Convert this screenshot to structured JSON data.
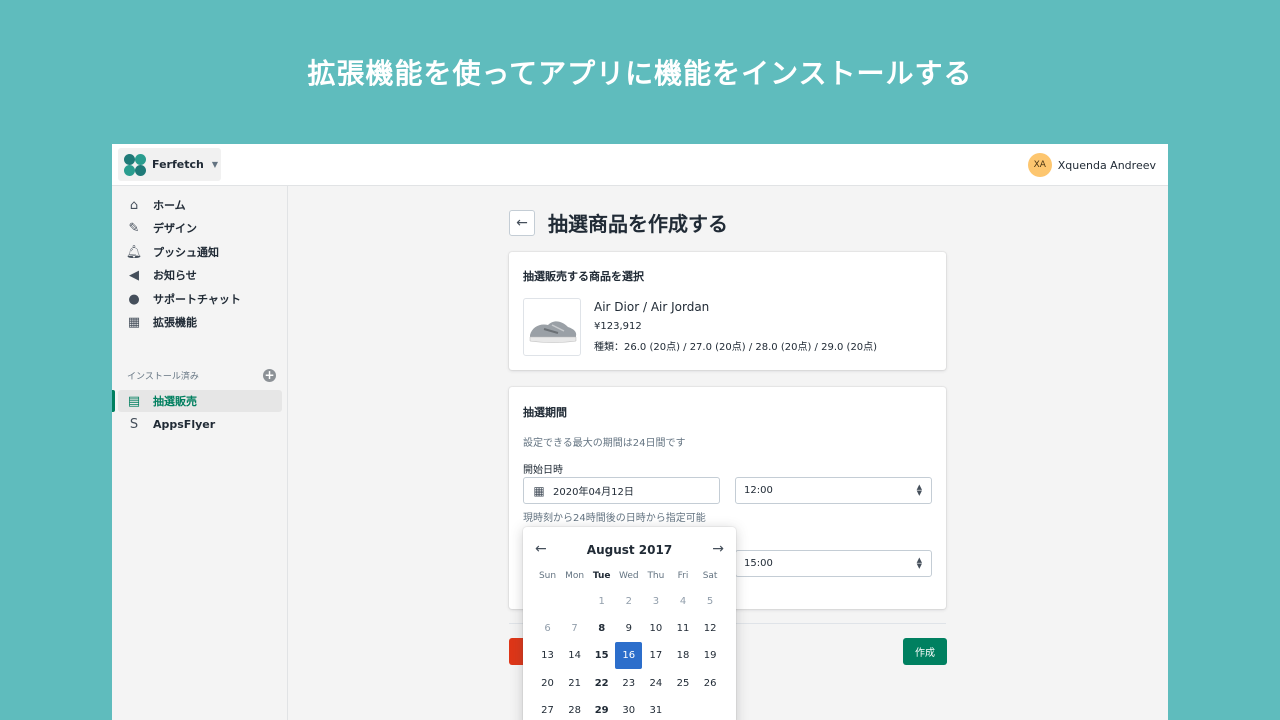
{
  "headline": "拡張機能を使ってアプリに機能をインストールする",
  "topbar": {
    "store_name": "Ferfetch",
    "user_initials": "XA",
    "user_name": "Xquenda Andreev"
  },
  "sidebar": {
    "items": [
      {
        "label": "ホーム",
        "icon": "home-icon"
      },
      {
        "label": "デザイン",
        "icon": "design-icon"
      },
      {
        "label": "プッシュ通知",
        "icon": "bell-icon"
      },
      {
        "label": "お知らせ",
        "icon": "megaphone-icon"
      },
      {
        "label": "サポートチャット",
        "icon": "chat-icon"
      },
      {
        "label": "拡張機能",
        "icon": "apps-icon"
      }
    ],
    "installed_label": "インストール済み",
    "installed_items": [
      {
        "label": "抽選販売",
        "icon": "store-icon",
        "active": true
      },
      {
        "label": "AppsFlyer",
        "icon": "shopping-bag-icon",
        "active": false
      }
    ]
  },
  "page": {
    "title": "抽選商品を作成する"
  },
  "product_card": {
    "title": "抽選販売する商品を選択",
    "product_name": "Air Dior / Air Jordan",
    "price": "¥123,912",
    "variants": "種類：26.0 (20点) / 27.0 (20点) / 28.0 (20点) / 29.0 (20点)"
  },
  "period_card": {
    "title": "抽選期間",
    "help_text": "設定できる最大の期間は24日間です",
    "start_label": "開始日時",
    "start_date": "2020年04月12日",
    "start_time": "12:00",
    "end_time": "15:00",
    "hint": "現時刻から24時間後の日時から指定可能"
  },
  "actions": {
    "create_label": "作成"
  },
  "datepicker": {
    "month_label": "August 2017",
    "weekdays": [
      "Sun",
      "Mon",
      "Tue",
      "Wed",
      "Thu",
      "Fri",
      "Sat"
    ],
    "today_weekday": "Tue",
    "weeks": [
      [
        "",
        "",
        "1",
        "2",
        "3",
        "4",
        "5"
      ],
      [
        "6",
        "7",
        "8",
        "9",
        "10",
        "11",
        "12"
      ],
      [
        "13",
        "14",
        "15",
        "16",
        "17",
        "18",
        "19"
      ],
      [
        "20",
        "21",
        "22",
        "23",
        "24",
        "25",
        "26"
      ],
      [
        "27",
        "28",
        "29",
        "30",
        "31",
        "",
        ""
      ]
    ],
    "disabled_days": [
      "1",
      "2",
      "3",
      "4",
      "5",
      "6",
      "7"
    ],
    "selected_day": "16"
  },
  "colors": {
    "background": "#5fbcbd",
    "accent_green": "#008060",
    "selected_blue": "#2c6ecb",
    "danger_red": "#de3618"
  }
}
